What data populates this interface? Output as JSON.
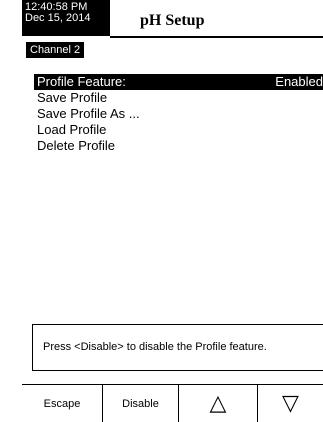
{
  "header": {
    "time": "12:40:58 PM",
    "date": "Dec 15, 2014",
    "title": "pH Setup",
    "channel": "Channel 2"
  },
  "menu": {
    "items": [
      {
        "label": "Profile Feature:",
        "value": "Enabled",
        "selected": true
      },
      {
        "label": "Save Profile"
      },
      {
        "label": "Save Profile As ..."
      },
      {
        "label": "Load Profile"
      },
      {
        "label": "Delete Profile"
      }
    ]
  },
  "message": {
    "text": "Press <Disable> to disable the Profile feature."
  },
  "softkeys": {
    "escape": "Escape",
    "disable": "Disable",
    "up_glyph": "△",
    "down_glyph": "▽"
  }
}
